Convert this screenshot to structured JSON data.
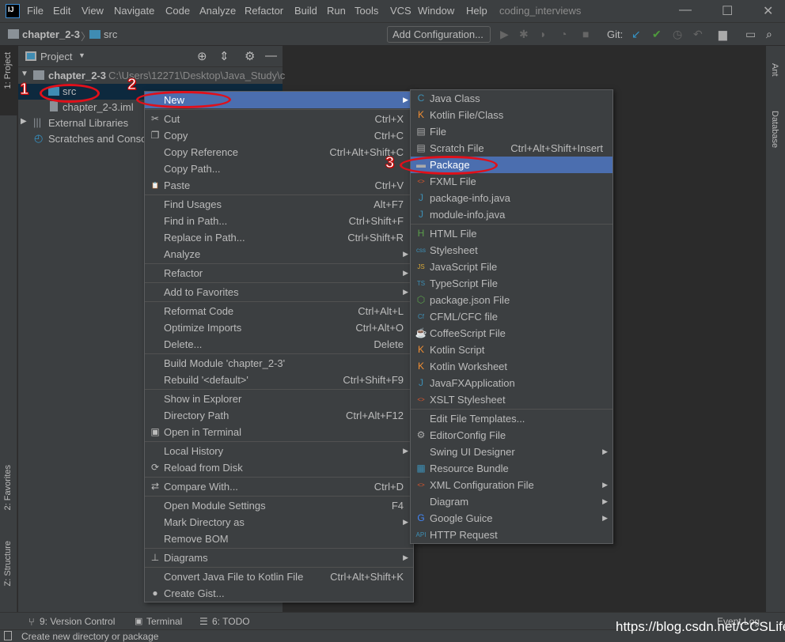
{
  "app": {
    "logo": "IJ",
    "title": "coding_interviews",
    "menu": [
      "File",
      "Edit",
      "View",
      "Navigate",
      "Code",
      "Analyze",
      "Refactor",
      "Build",
      "Run",
      "Tools",
      "VCS",
      "Window",
      "Help"
    ]
  },
  "breadcrumb": {
    "project": "chapter_2-3",
    "folder": "src"
  },
  "toolbar": {
    "add_configuration": "Add Configuration...",
    "git_label": "Git:"
  },
  "left_tools": {
    "project": "1: Project",
    "favorites": "2: Favorites",
    "structure": "Z: Structure"
  },
  "right_tools": {
    "ant": "Ant",
    "database": "Database"
  },
  "project_panel": {
    "title": "Project",
    "tree": {
      "root": "chapter_2-3",
      "root_path": "C:\\Users\\12271\\Desktop\\Java_Study\\c",
      "src": "src",
      "iml": "chapter_2-3.iml",
      "ext_libs": "External Libraries",
      "scratches": "Scratches and Conso"
    }
  },
  "context_menu": [
    {
      "label": "New",
      "submenu": true,
      "highlighted": true
    },
    {
      "sep": true
    },
    {
      "label": "Cut",
      "shortcut": "Ctrl+X",
      "icon": "scissors-icon",
      "glyph": "✂"
    },
    {
      "label": "Copy",
      "shortcut": "Ctrl+C",
      "icon": "copy-icon",
      "glyph": "❐"
    },
    {
      "label": "Copy Reference",
      "shortcut": "Ctrl+Alt+Shift+C"
    },
    {
      "label": "Copy Path...",
      "shortcut": ""
    },
    {
      "label": "Paste",
      "shortcut": "Ctrl+V",
      "icon": "paste-icon",
      "glyph": "📋"
    },
    {
      "sep": true
    },
    {
      "label": "Find Usages",
      "shortcut": "Alt+F7"
    },
    {
      "label": "Find in Path...",
      "shortcut": "Ctrl+Shift+F"
    },
    {
      "label": "Replace in Path...",
      "shortcut": "Ctrl+Shift+R"
    },
    {
      "label": "Analyze",
      "submenu": true
    },
    {
      "sep": true
    },
    {
      "label": "Refactor",
      "submenu": true
    },
    {
      "sep": true
    },
    {
      "label": "Add to Favorites",
      "submenu": true
    },
    {
      "sep": true
    },
    {
      "label": "Reformat Code",
      "shortcut": "Ctrl+Alt+L"
    },
    {
      "label": "Optimize Imports",
      "shortcut": "Ctrl+Alt+O"
    },
    {
      "label": "Delete...",
      "shortcut": "Delete"
    },
    {
      "sep": true
    },
    {
      "label": "Build Module 'chapter_2-3'"
    },
    {
      "label": "Rebuild '<default>'",
      "shortcut": "Ctrl+Shift+F9"
    },
    {
      "sep": true
    },
    {
      "label": "Show in Explorer"
    },
    {
      "label": "Directory Path",
      "shortcut": "Ctrl+Alt+F12"
    },
    {
      "label": "Open in Terminal",
      "icon": "terminal-icon",
      "glyph": "▣"
    },
    {
      "sep": true
    },
    {
      "label": "Local History",
      "submenu": true
    },
    {
      "label": "Reload from Disk",
      "icon": "reload-icon",
      "glyph": "⟳"
    },
    {
      "sep": true
    },
    {
      "label": "Compare With...",
      "shortcut": "Ctrl+D",
      "icon": "compare-icon",
      "glyph": "⇄"
    },
    {
      "sep": true
    },
    {
      "label": "Open Module Settings",
      "shortcut": "F4"
    },
    {
      "label": "Mark Directory as",
      "submenu": true
    },
    {
      "label": "Remove BOM"
    },
    {
      "sep": true
    },
    {
      "label": "Diagrams",
      "submenu": true,
      "icon": "diagram-icon",
      "glyph": "⊥"
    },
    {
      "sep": true
    },
    {
      "label": "Convert Java File to Kotlin File",
      "shortcut": "Ctrl+Alt+Shift+K"
    },
    {
      "label": "Create Gist...",
      "icon": "github-icon",
      "glyph": "●"
    }
  ],
  "new_submenu": [
    {
      "label": "Java Class",
      "icon": "java-class-icon",
      "glyph": "C",
      "color": "#3d8fb5"
    },
    {
      "label": "Kotlin File/Class",
      "icon": "kotlin-icon",
      "glyph": "K",
      "color": "#f18e33"
    },
    {
      "label": "File",
      "icon": "file-icon",
      "glyph": "▤",
      "color": "#aaaaaa"
    },
    {
      "label": "Scratch File",
      "shortcut": "Ctrl+Alt+Shift+Insert",
      "icon": "scratch-file-icon",
      "glyph": "▤",
      "color": "#aaaaaa"
    },
    {
      "label": "Package",
      "highlighted": true,
      "icon": "package-icon",
      "glyph": "▬",
      "color": "#aaaaaa"
    },
    {
      "label": "FXML File",
      "icon": "fxml-icon",
      "glyph": "<>",
      "color": "#e2572b"
    },
    {
      "label": "package-info.java",
      "icon": "java-file-icon",
      "glyph": "J",
      "color": "#3d8fb5"
    },
    {
      "label": "module-info.java",
      "icon": "java-file-icon",
      "glyph": "J",
      "color": "#3d8fb5"
    },
    {
      "sep": true
    },
    {
      "label": "HTML File",
      "icon": "html-icon",
      "glyph": "H",
      "color": "#5a9e4a"
    },
    {
      "label": "Stylesheet",
      "icon": "css-icon",
      "glyph": "css",
      "color": "#3d8fb5"
    },
    {
      "label": "JavaScript File",
      "icon": "javascript-icon",
      "glyph": "JS",
      "color": "#d8a838"
    },
    {
      "label": "TypeScript File",
      "icon": "typescript-icon",
      "glyph": "TS",
      "color": "#3d8fb5"
    },
    {
      "label": "package.json File",
      "icon": "npm-icon",
      "glyph": "⬡",
      "color": "#5a9e4a"
    },
    {
      "label": "CFML/CFC file",
      "icon": "cfml-icon",
      "glyph": "Cf",
      "color": "#3d8fb5"
    },
    {
      "label": "CoffeeScript File",
      "icon": "coffeescript-icon",
      "glyph": "☕",
      "color": "#3d8fb5"
    },
    {
      "label": "Kotlin Script",
      "icon": "kotlin-icon",
      "glyph": "K",
      "color": "#f18e33"
    },
    {
      "label": "Kotlin Worksheet",
      "icon": "kotlin-icon",
      "glyph": "K",
      "color": "#f18e33"
    },
    {
      "label": "JavaFXApplication",
      "icon": "java-file-icon",
      "glyph": "J",
      "color": "#3d8fb5"
    },
    {
      "label": "XSLT Stylesheet",
      "icon": "xslt-icon",
      "glyph": "<>",
      "color": "#e2572b"
    },
    {
      "sep": true
    },
    {
      "label": "Edit File Templates..."
    },
    {
      "label": "EditorConfig File",
      "icon": "gear-icon",
      "glyph": "⚙",
      "color": "#aaaaaa"
    },
    {
      "label": "Swing UI Designer",
      "submenu": true
    },
    {
      "label": "Resource Bundle",
      "icon": "resource-bundle-icon",
      "glyph": "▦",
      "color": "#3d8fb5"
    },
    {
      "label": "XML Configuration File",
      "submenu": true,
      "icon": "xml-icon",
      "glyph": "<>",
      "color": "#e2572b"
    },
    {
      "label": "Diagram",
      "submenu": true
    },
    {
      "label": "Google Guice",
      "submenu": true,
      "icon": "google-icon",
      "glyph": "G",
      "color": "#4285f4"
    },
    {
      "label": "HTTP Request",
      "icon": "api-icon",
      "glyph": "API",
      "color": "#3d8fb5"
    }
  ],
  "bottom_tools": {
    "version_control": "9: Version Control",
    "terminal": "Terminal",
    "todo": "6: TODO",
    "event_log": "Event Log"
  },
  "status": {
    "message": "Create new directory or package"
  },
  "watermark": "https://blog.csdn.net/CCSLife",
  "annotations": {
    "step1": "1",
    "step2": "2",
    "step3": "3"
  },
  "colors": {
    "highlight": "#4b6eaf",
    "annotation": "#e0101a",
    "selection": "#0d293e"
  }
}
